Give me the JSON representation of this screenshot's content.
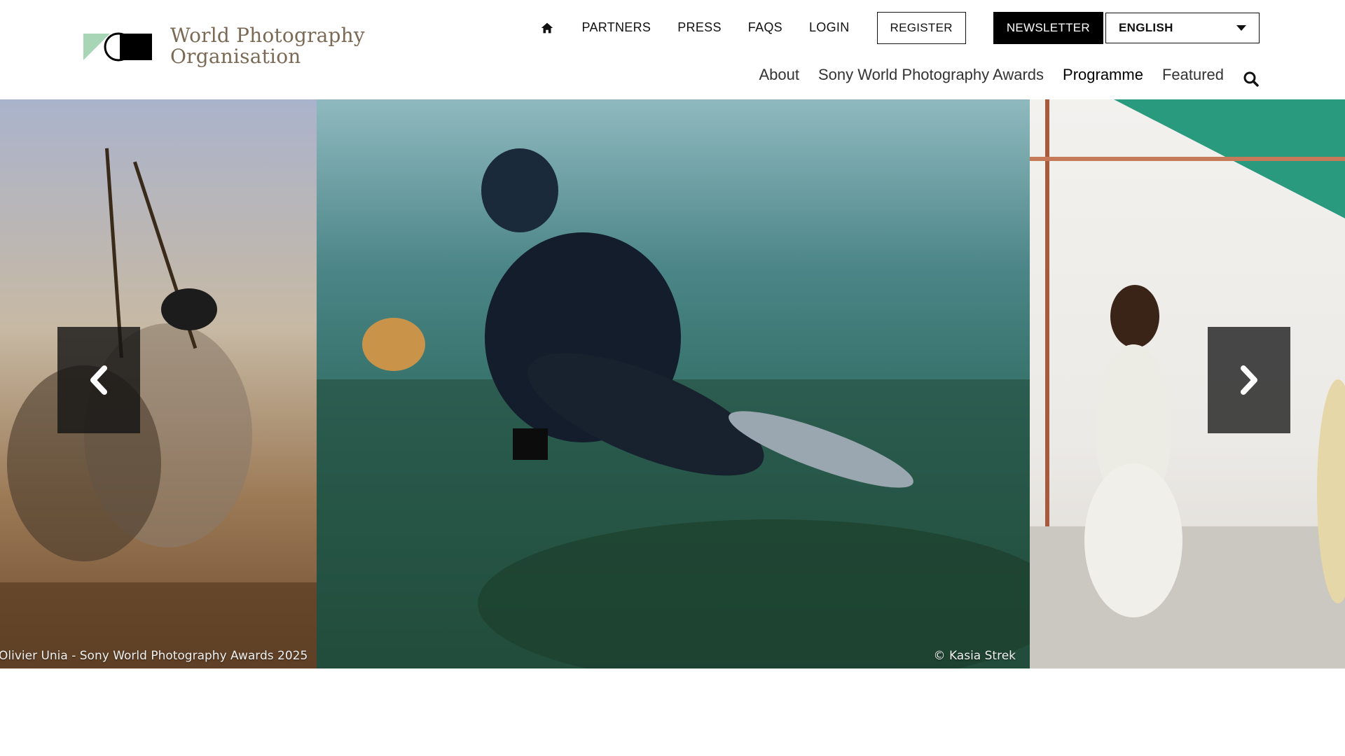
{
  "logo": {
    "line1": "World Photography",
    "line2": "Organisation",
    "icon": "wpo-logo-mark"
  },
  "top_nav": {
    "home_icon": "home-icon",
    "items": [
      "PARTNERS",
      "PRESS",
      "FAQS",
      "LOGIN"
    ],
    "register_label": "REGISTER",
    "newsletter_label": "NEWSLETTER",
    "language": {
      "selected": "ENGLISH",
      "icon": "caret-down-icon"
    }
  },
  "main_nav": {
    "items": [
      "About",
      "Sony World Photography Awards",
      "Programme",
      "Featured"
    ],
    "active": "Programme",
    "search_icon": "search-icon"
  },
  "carousel": {
    "slides": [
      {
        "caption": "Olivier Unia - Sony World Photography Awards 2025"
      },
      {
        "caption": "© Kasia Strek"
      },
      {
        "caption": ""
      }
    ],
    "prev_icon": "chevron-left-icon",
    "next_icon": "chevron-right-icon"
  },
  "colors": {
    "logo_text": "#7a6a55",
    "logo_green": "#a8d5b5",
    "nav_active_underline": "#000000",
    "newsletter_bg": "#000000"
  }
}
